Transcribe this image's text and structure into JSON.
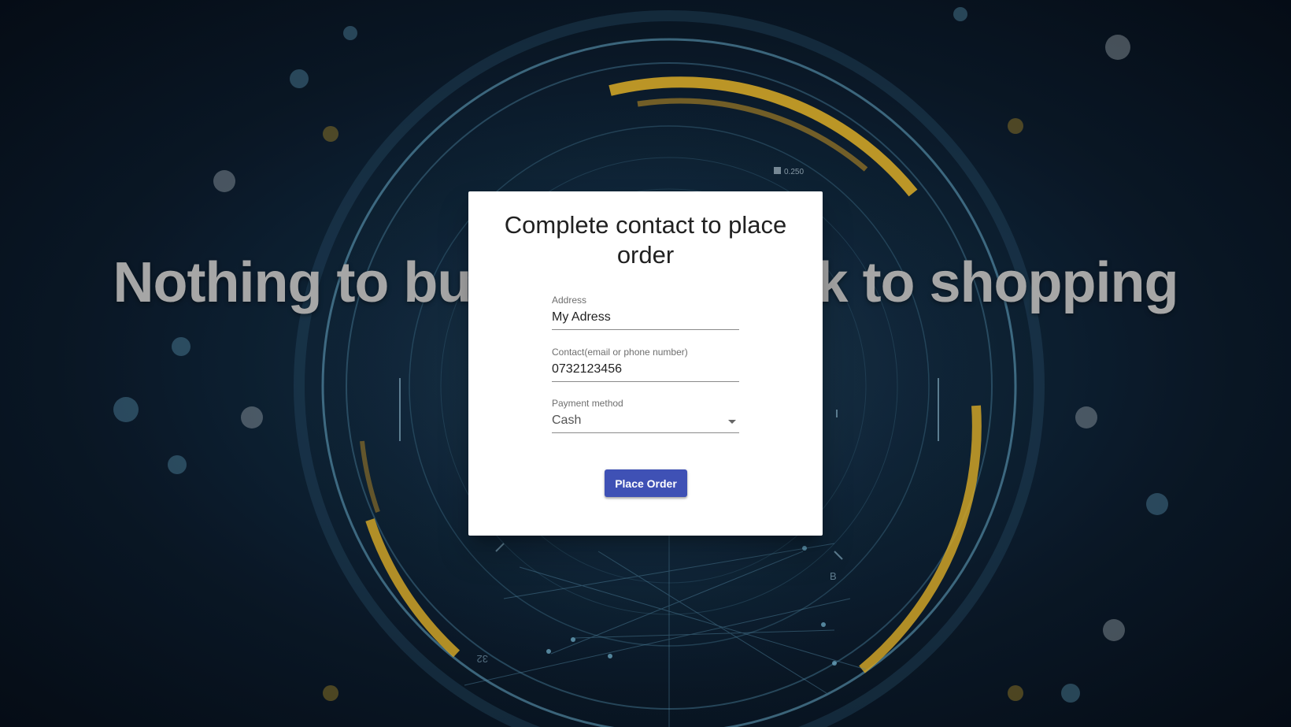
{
  "background": {
    "hero_text": "Nothing to buy yet! Go back to shopping",
    "hud_readout": "0.250",
    "marker_letter": "B",
    "marker_number": "32"
  },
  "dialog": {
    "title": "Complete contact to place order",
    "address": {
      "label": "Address",
      "value": "My Adress"
    },
    "contact": {
      "label": "Contact(email or phone number)",
      "value": "0732123456"
    },
    "payment": {
      "label": "Payment method",
      "selected": "Cash"
    },
    "submit_label": "Place Order"
  },
  "colors": {
    "accent": "#3f51b5",
    "background_dark": "#0a1827",
    "hud_yellow": "#e0b12a",
    "hud_cyan": "#6fb4d4"
  }
}
